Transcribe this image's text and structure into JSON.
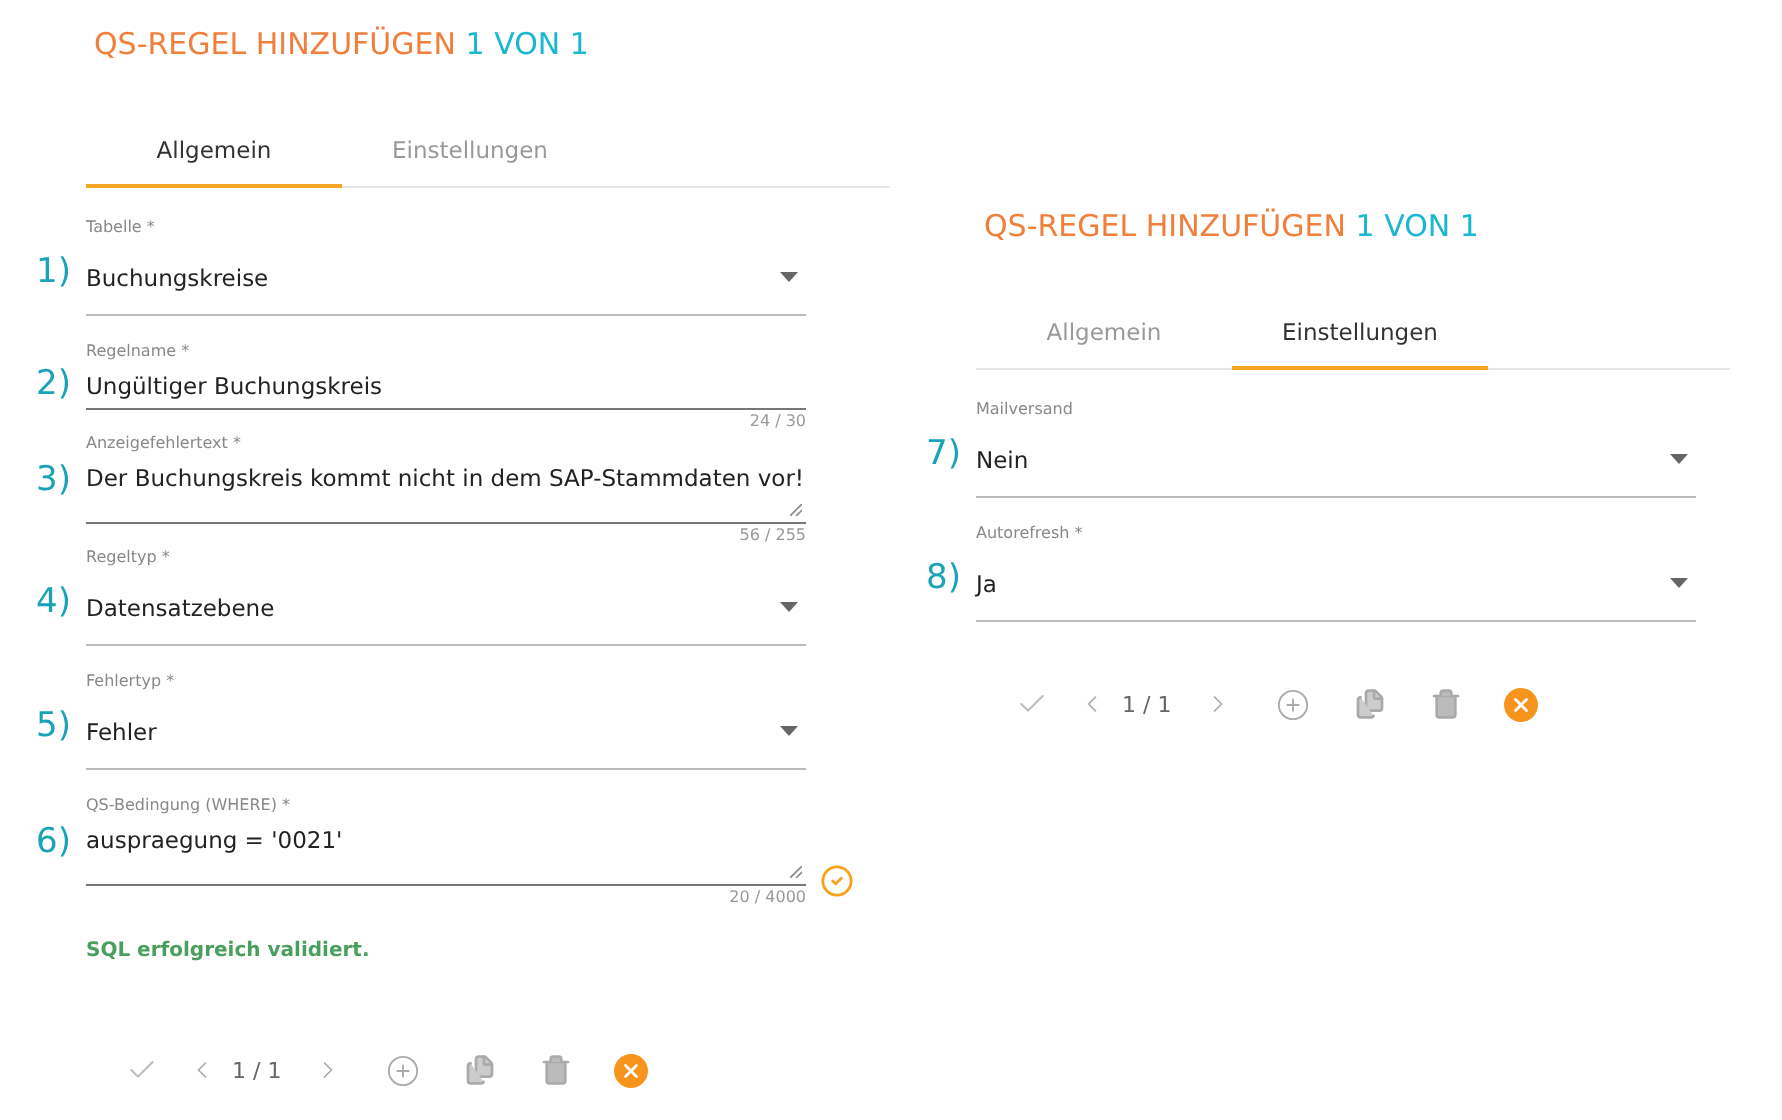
{
  "panels": [
    {
      "title": "QS-REGEL HINZUFÜGEN",
      "title_count": "1 VON 1",
      "tabs": [
        {
          "label": "Allgemein",
          "selected": true
        },
        {
          "label": "Einstellungen",
          "selected": false
        }
      ],
      "fields": [
        {
          "kind": "select",
          "marker": "1)",
          "label": "Tabelle *",
          "value": "Buchungskreise"
        },
        {
          "kind": "input",
          "marker": "2)",
          "label": "Regelname *",
          "value": "Ungültiger Buchungskreis",
          "counter": "24 / 30"
        },
        {
          "kind": "textarea",
          "marker": "3)",
          "label": "Anzeigefehlertext *",
          "value": "Der Buchungskreis kommt nicht in dem SAP-Stammdaten vor!",
          "counter": "56 / 255"
        },
        {
          "kind": "select",
          "marker": "4)",
          "label": "Regeltyp *",
          "value": "Datensatzebene"
        },
        {
          "kind": "select",
          "marker": "5)",
          "label": "Fehlertyp *",
          "value": "Fehler"
        },
        {
          "kind": "textarea",
          "marker": "6)",
          "label": "QS-Bedingung (WHERE) *",
          "value": "auspraegung = '0021'",
          "counter": "20 / 4000",
          "validated": true
        }
      ],
      "message": "SQL erfolgreich validiert.",
      "pager": "1 / 1"
    },
    {
      "title": "QS-REGEL HINZUFÜGEN",
      "title_count": "1 VON 1",
      "tabs": [
        {
          "label": "Allgemein",
          "selected": false
        },
        {
          "label": "Einstellungen",
          "selected": true
        }
      ],
      "fields": [
        {
          "kind": "select",
          "marker": "7)",
          "label": "Mailversand",
          "value": "Nein"
        },
        {
          "kind": "select",
          "marker": "8)",
          "label": "Autorefresh *",
          "value": "Ja"
        }
      ],
      "pager": "1 / 1"
    }
  ]
}
